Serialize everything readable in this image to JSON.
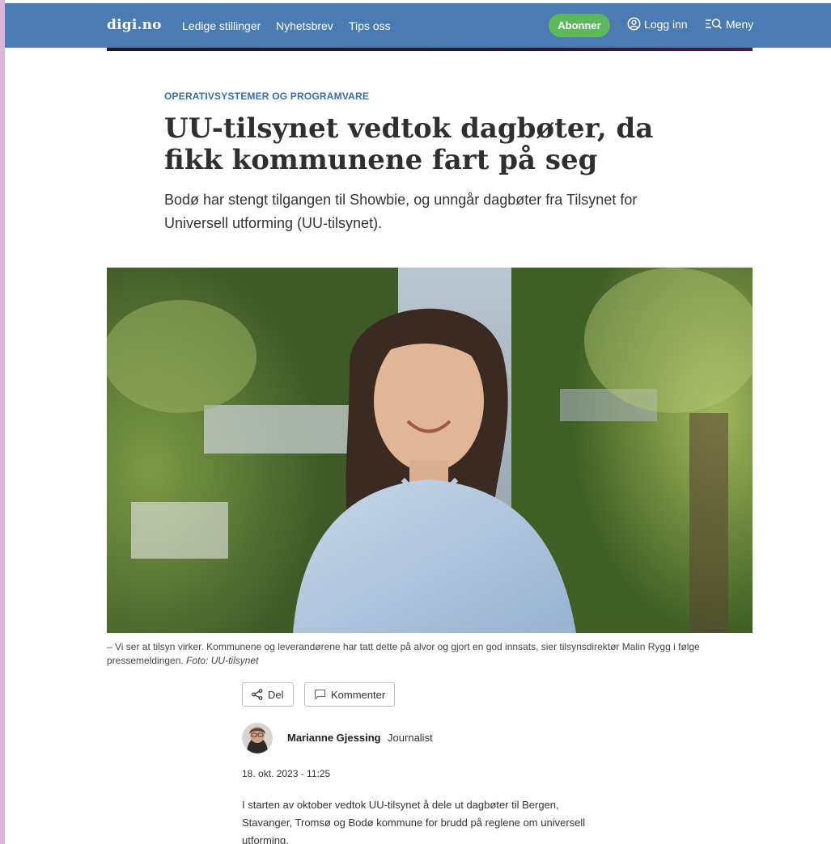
{
  "header": {
    "logo": "digi.no",
    "nav": [
      "Ledige stillinger",
      "Nyhetsbrev",
      "Tips oss"
    ],
    "subscribe_label": "Abonner",
    "login_label": "Logg inn",
    "menu_label": "Meny"
  },
  "article": {
    "category": "OPERATIVSYSTEMER OG PROGRAMVARE",
    "title": "UU-tilsynet vedtok dagbøter, da fikk kommunene fart på seg",
    "lede": "Bodø har stengt tilgangen til Showbie, og unngår dagbøter fra Tilsynet for Universell utforming (UU-tilsynet).",
    "caption": "– Vi ser at tilsyn virker. Kommunene og leverandørene har tatt dette på alvor og gjort en god innsats, sier tilsynsdirektør Malin Rygg i følge pressemeldingen.",
    "photo_credit": "Foto: UU-tilsynet",
    "share_label": "Del",
    "comment_label": "Kommenter",
    "author_name": "Marianne Gjessing",
    "author_role": "Journalist",
    "date": "18. okt. 2023 - 11:25",
    "body": "I starten av oktober vedtok UU-tilsynet å dele ut dagbøter til Bergen, Stavanger, Tromsø og Bodø kommune for brudd på reglene om universell utforming."
  },
  "colors": {
    "header_bg": "#4a7bb3",
    "subscribe_bg": "#5cb85c",
    "category": "#3a6ea5",
    "outer_bg": "#dcb5dc"
  },
  "icons": {
    "login": "user-circle-icon",
    "menu": "menu-search-icon",
    "share": "share-icon",
    "comment": "comment-icon"
  }
}
